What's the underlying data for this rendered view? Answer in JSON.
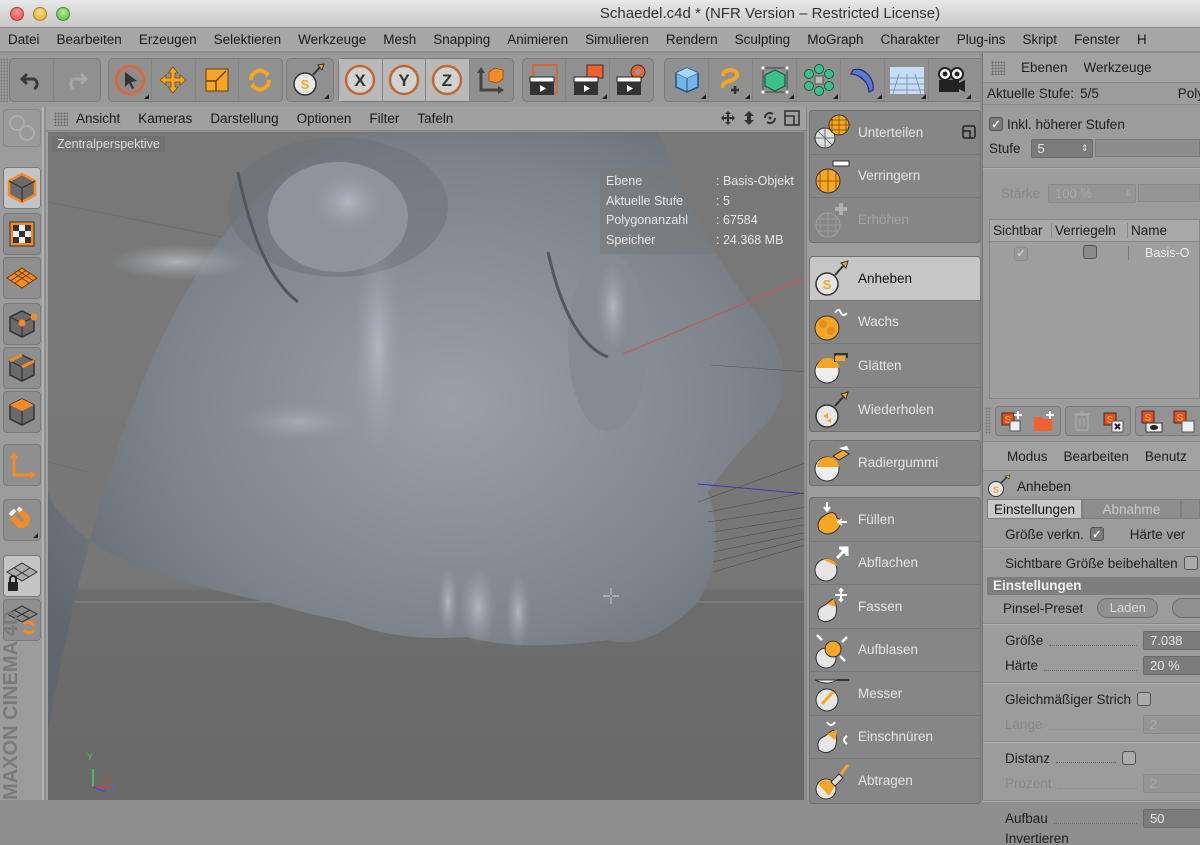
{
  "window": {
    "title": "Schaedel.c4d * (NFR Version – Restricted License)"
  },
  "menubar": [
    "Datei",
    "Bearbeiten",
    "Erzeugen",
    "Selektieren",
    "Werkzeuge",
    "Mesh",
    "Snapping",
    "Animieren",
    "Simulieren",
    "Rendern",
    "Sculpting",
    "MoGraph",
    "Charakter",
    "Plug-ins",
    "Skript",
    "Fenster",
    "H"
  ],
  "toolbar": {
    "groups": [
      {
        "name": "history",
        "buttons": [
          "undo-icon",
          "redo-icon"
        ]
      },
      {
        "name": "transform",
        "buttons": [
          "select-arrow-icon",
          "move-icon",
          "scale-icon",
          "rotate-icon"
        ]
      },
      {
        "name": "sculpt",
        "buttons": [
          "sculpt-brush-icon"
        ]
      },
      {
        "name": "axis-lock",
        "buttons": [
          "x-axis-icon",
          "y-axis-icon",
          "z-axis-icon",
          "coordinate-system-icon"
        ]
      },
      {
        "name": "render",
        "buttons": [
          "render-view-icon",
          "render-picture-viewer-icon",
          "render-settings-icon"
        ]
      },
      {
        "name": "objects",
        "buttons": [
          "cube-icon",
          "spline-pen-icon",
          "subdivision-surface-icon",
          "array-icon",
          "deformer-icon",
          "floor-icon",
          "camera-icon"
        ]
      }
    ]
  },
  "viewport": {
    "menu": [
      "Ansicht",
      "Kameras",
      "Darstellung",
      "Optionen",
      "Filter",
      "Tafeln"
    ],
    "projection_label": "Zentralperspektive",
    "hud": [
      {
        "key": "Ebene",
        "value": ": Basis-Objekt"
      },
      {
        "key": "Aktuelle Stufe",
        "value": ": 5"
      },
      {
        "key": "Polygonanzahl",
        "value": ": 67584"
      },
      {
        "key": "Speicher",
        "value": ": 24.368 MB"
      }
    ],
    "axis_labels": {
      "y": "Y",
      "x": "X",
      "z": "Z"
    },
    "branding": "MAXON CINEMA 4D"
  },
  "left_tools": [
    "model-mode-icon",
    "texture-mode-icon",
    "workplane-mode-icon",
    "points-mode-icon",
    "edges-mode-icon",
    "polygons-mode-icon",
    "axis-mode-icon",
    "snap-magnet-icon",
    "locked-workplane-icon",
    "workplane-rotate-icon"
  ],
  "sculpt_tools": {
    "group1": [
      {
        "label": "Unterteilen",
        "state": "normal"
      },
      {
        "label": "Verringern",
        "state": "normal"
      },
      {
        "label": "Erhöhen",
        "state": "disabled"
      }
    ],
    "group2": [
      {
        "label": "Anheben",
        "state": "selected"
      },
      {
        "label": "Wachs",
        "state": "normal"
      },
      {
        "label": "Glätten",
        "state": "normal"
      },
      {
        "label": "Wiederholen",
        "state": "normal"
      }
    ],
    "group3": [
      {
        "label": "Radiergummi",
        "state": "normal"
      }
    ],
    "group4": [
      {
        "label": "Füllen",
        "state": "normal"
      },
      {
        "label": "Abflachen",
        "state": "normal"
      },
      {
        "label": "Fassen",
        "state": "normal"
      },
      {
        "label": "Aufblasen",
        "state": "normal"
      },
      {
        "label": "Messer",
        "state": "normal"
      },
      {
        "label": "Einschnüren",
        "state": "normal"
      },
      {
        "label": "Abtragen",
        "state": "normal"
      }
    ]
  },
  "layers_panel": {
    "tabs": [
      "Ebenen",
      "Werkzeuge"
    ],
    "current_level_label": "Aktuelle Stufe:",
    "current_level_value": "5/5",
    "poly_label": "Poly",
    "include_higher_label": "Inkl. höherer Stufen",
    "include_higher_checked": true,
    "level_label": "Stufe",
    "level_value": "5",
    "strength_label": "Stärke",
    "strength_value": "100 %",
    "columns": [
      "Sichtbar",
      "Verriegeln",
      "Name"
    ],
    "rows": [
      {
        "visible": true,
        "locked": false,
        "name": "Basis-O"
      }
    ]
  },
  "attributes_panel": {
    "menu": [
      "Modus",
      "Bearbeiten",
      "Benutz"
    ],
    "tool_name": "Anheben",
    "tabs": [
      "Einstellungen",
      "Abnahme"
    ],
    "size_link_label": "Größe verkn.",
    "size_link_checked": true,
    "hardness_link_label": "Härte ver",
    "keep_visible_size_label": "Sichtbare Größe beibehalten",
    "section_title": "Einstellungen",
    "brush_preset_label": "Pinsel-Preset",
    "load_button": "Laden",
    "size_label": "Größe",
    "size_value": "7.038",
    "hardness_label": "Härte",
    "hardness_value": "20 %",
    "steady_stroke_label": "Gleichmäßiger Strich",
    "length_label": "Länge",
    "length_value": "2",
    "distance_label": "Distanz",
    "percent_label": "Prozent",
    "percent_value": "2",
    "buildup_label": "Aufbau",
    "buildup_value": "50",
    "invert_label": "Invertieren"
  }
}
